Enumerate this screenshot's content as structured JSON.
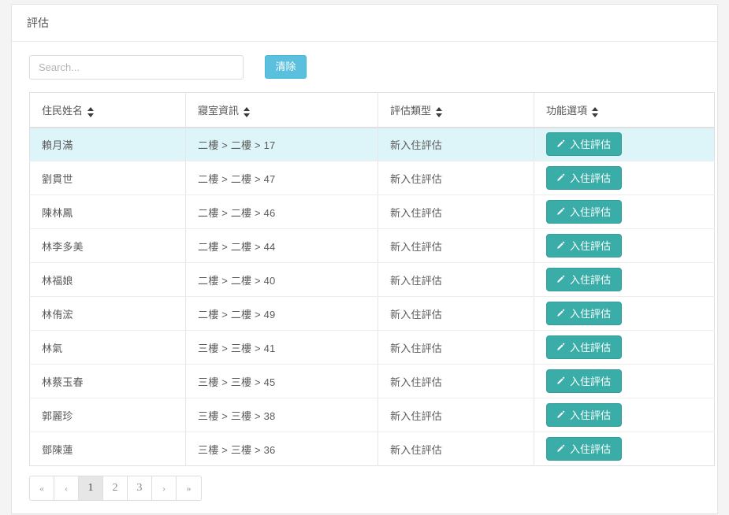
{
  "card": {
    "header_title": "評估"
  },
  "search": {
    "value": "",
    "placeholder": "Search...",
    "clear_label": "清除"
  },
  "table": {
    "columns": [
      {
        "label": "住民姓名",
        "sortable": true
      },
      {
        "label": "寢室資訊",
        "sortable": true
      },
      {
        "label": "評估類型",
        "sortable": true
      },
      {
        "label": "功能選項",
        "sortable": true
      }
    ],
    "rows": [
      {
        "name": "賴月滿",
        "room": "二樓 > 二樓 > 17",
        "type": "新入住評估",
        "action": "入住評估",
        "highlight": true
      },
      {
        "name": "劉貫世",
        "room": "二樓 > 二樓 > 47",
        "type": "新入住評估",
        "action": "入住評估",
        "highlight": false
      },
      {
        "name": "陳林鳳",
        "room": "二樓 > 二樓 > 46",
        "type": "新入住評估",
        "action": "入住評估",
        "highlight": false
      },
      {
        "name": "林李多美",
        "room": "二樓 > 二樓 > 44",
        "type": "新入住評估",
        "action": "入住評估",
        "highlight": false
      },
      {
        "name": "林福娘",
        "room": "二樓 > 二樓 > 40",
        "type": "新入住評估",
        "action": "入住評估",
        "highlight": false
      },
      {
        "name": "林侑浤",
        "room": "二樓 > 二樓 > 49",
        "type": "新入住評估",
        "action": "入住評估",
        "highlight": false
      },
      {
        "name": "林氣",
        "room": "三樓 > 三樓 > 41",
        "type": "新入住評估",
        "action": "入住評估",
        "highlight": false
      },
      {
        "name": "林蔡玉春",
        "room": "三樓 > 三樓 > 45",
        "type": "新入住評估",
        "action": "入住評估",
        "highlight": false
      },
      {
        "name": "郭麗珍",
        "room": "三樓 > 三樓 > 38",
        "type": "新入住評估",
        "action": "入住評估",
        "highlight": false
      },
      {
        "name": "鄧陳蓮",
        "room": "三樓 > 三樓 > 36",
        "type": "新入住評估",
        "action": "入住評估",
        "highlight": false
      }
    ]
  },
  "pagination": {
    "items": [
      {
        "label": "«",
        "type": "arrow",
        "active": false
      },
      {
        "label": "‹",
        "type": "arrow",
        "active": false
      },
      {
        "label": "1",
        "type": "page",
        "active": true
      },
      {
        "label": "2",
        "type": "page",
        "active": false
      },
      {
        "label": "3",
        "type": "page",
        "active": false
      },
      {
        "label": "›",
        "type": "arrow",
        "active": false
      },
      {
        "label": "»",
        "type": "arrow",
        "active": false
      }
    ]
  },
  "colors": {
    "accent_teal": "#3aada8",
    "info_blue": "#5bc0de",
    "row_highlight": "#ddf5f8",
    "page_bg": "#f4f4f4"
  },
  "icons": {
    "pencil": "pencil-icon",
    "sort": "sort-updown-icon"
  }
}
